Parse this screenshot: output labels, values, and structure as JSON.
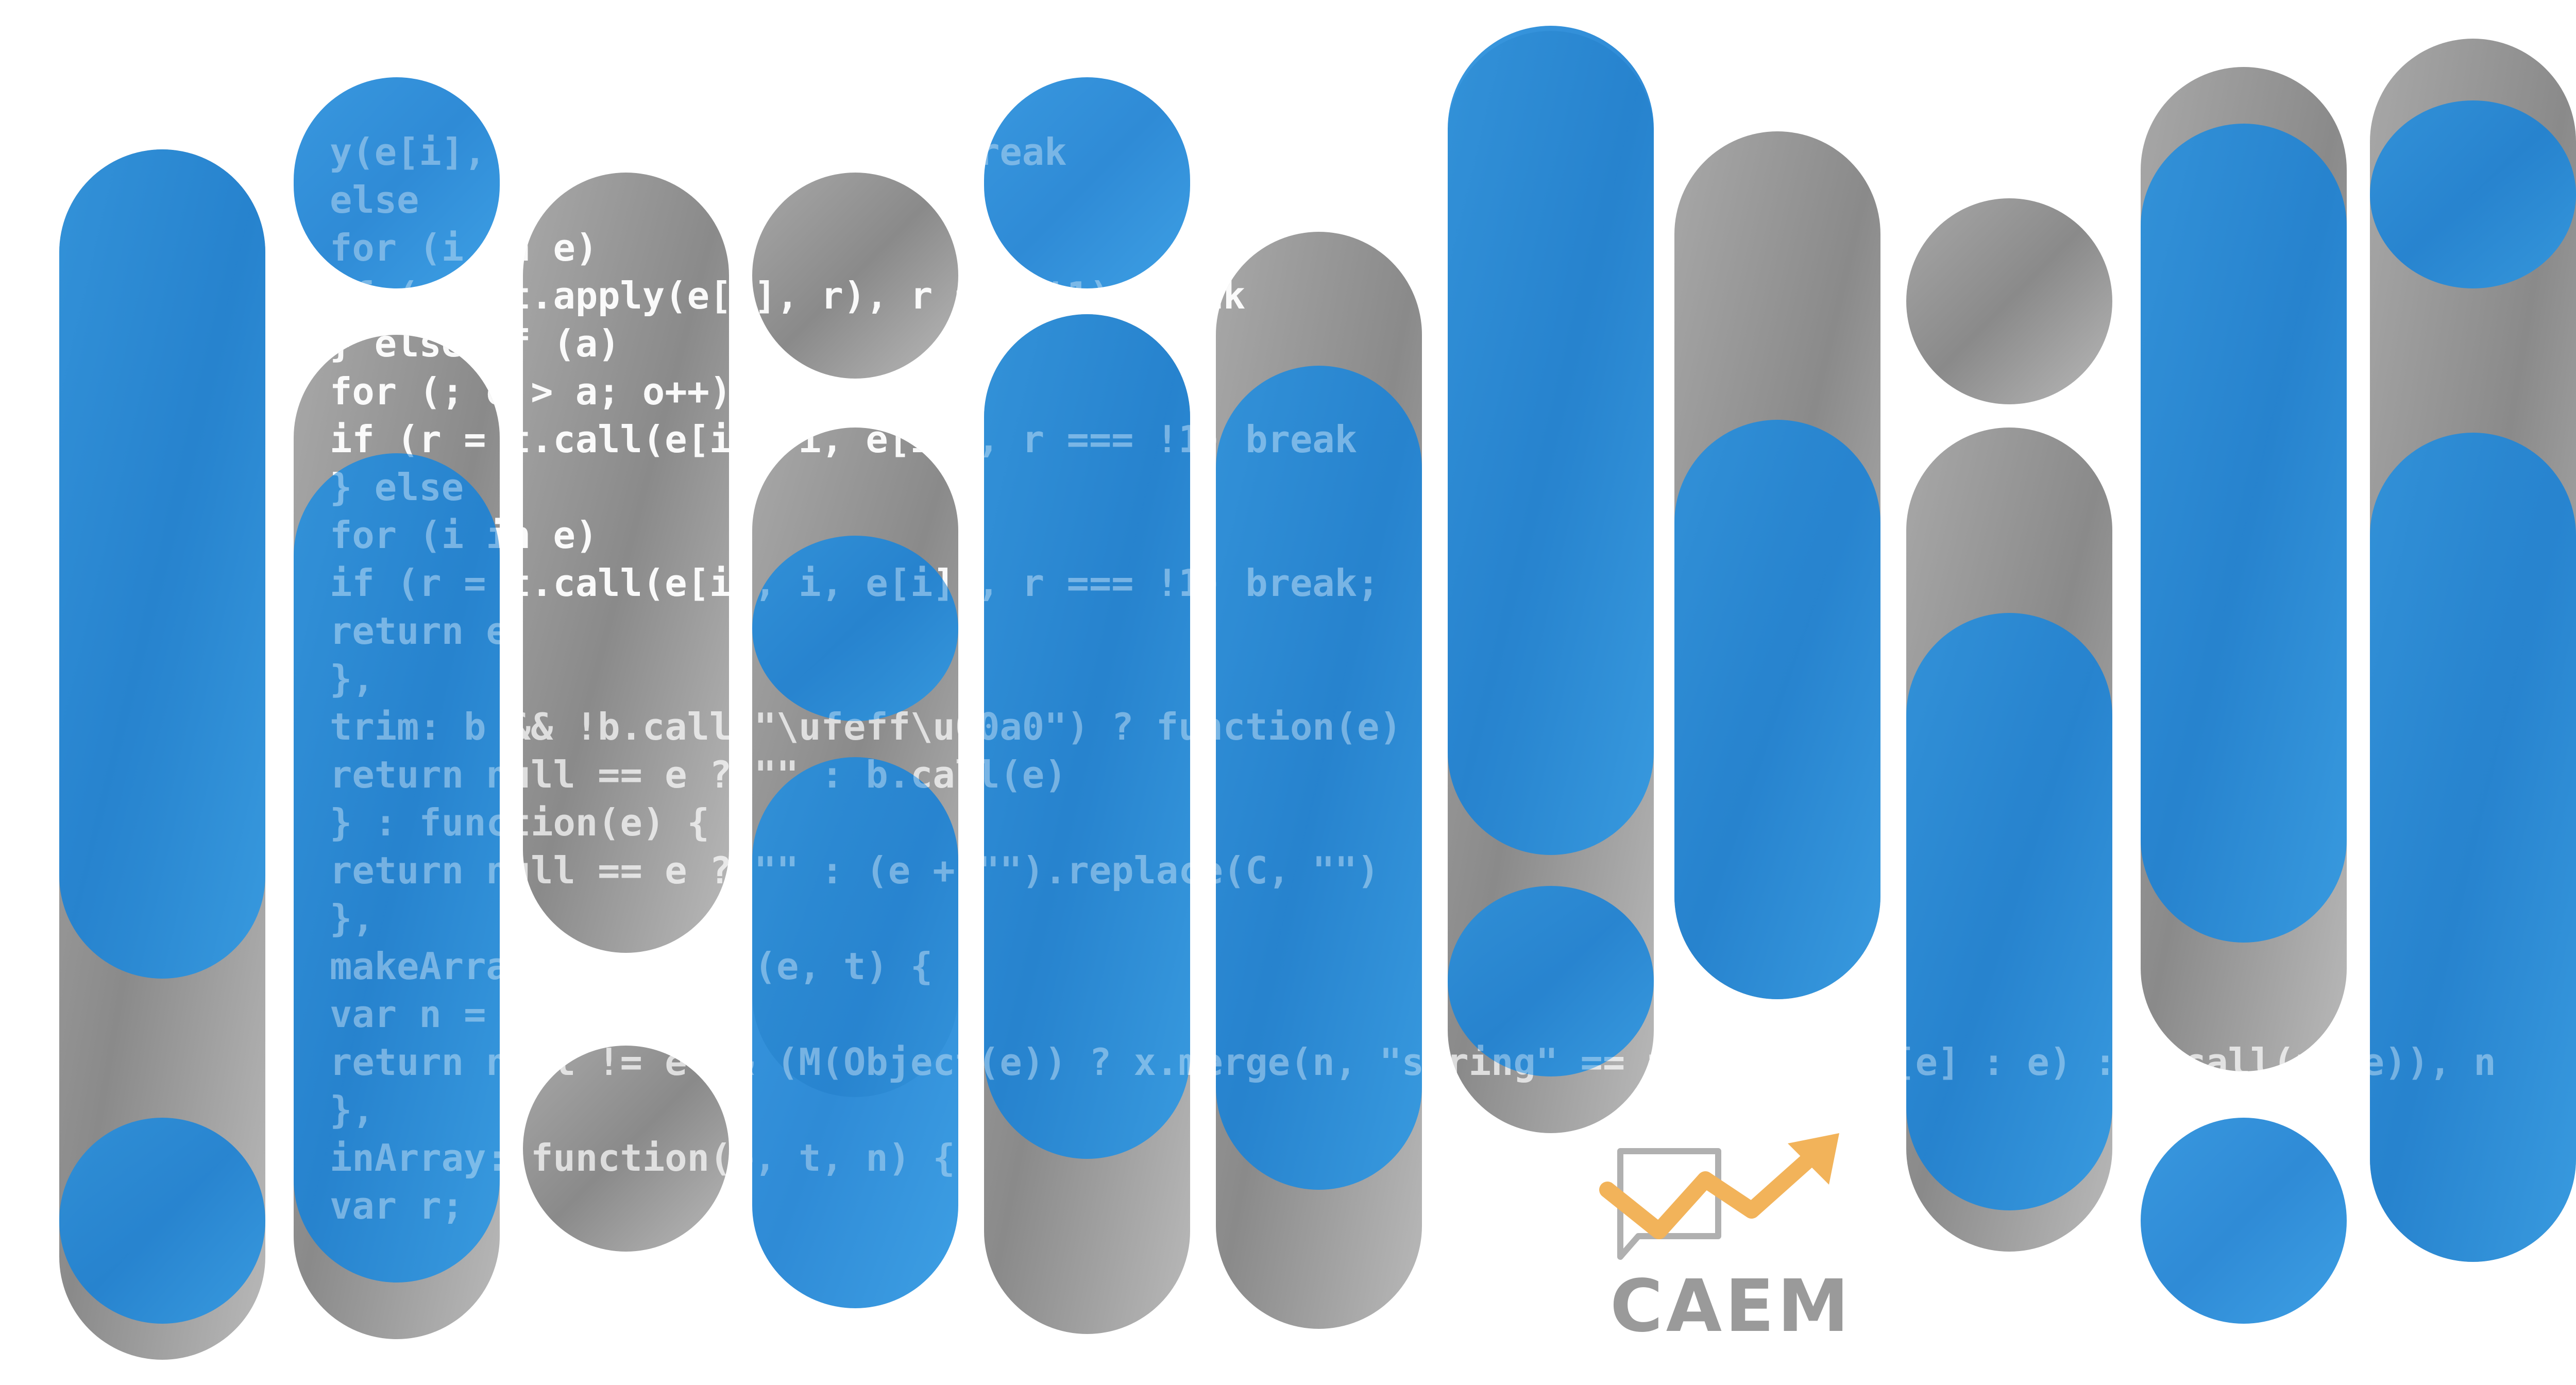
{
  "image": {
    "kind": "decorative-banner",
    "background": "#ffffff",
    "colors": {
      "blue": "#1f85d6",
      "blue_light": "#2f9ae6",
      "gray": "#8c8c8c",
      "gray_light": "#b4b4b4",
      "code_text": "#ffffff",
      "logo_gray": "#9a9a9a",
      "logo_orange": "#f2b35a"
    }
  },
  "code_lines": [
    "y(e[i], i, e[i]), r === !1) break",
    "    else",
    "        for (i in e)",
    "            if (r = t.apply(e[i], r), r === !1) break",
    "    } else if (a)",
    "        for (; o > a; o++)",
    "            if (r = t.call(e[i], i, e[i]), r === !1) break",
    "    } else",
    "        for (i in e)",
    "            if (r = t.call(e[i], i, e[i]), r === !1) break;",
    "    return e",
    "},",
    "trim: b && !b.call(\"\\ufeff\\u00a0\") ? function(e)",
    "    return null == e ? \"\" : b.call(e)",
    "} : function(e) {",
    "    return null == e ? \"\" : (e + \"\").replace(C, \"\")",
    "},",
    "makeArray: function(e, t) {",
    "    var n = t || [];",
    "    return null != e && (M(Object(e)) ? x.merge(n, \"string\" == typeof e ? [e] : e) : h.call(n, e)), n",
    "},",
    "inArray: function(e, t, n) {",
    "    var r;"
  ],
  "logo": {
    "text": "CAEM",
    "icon": "chat-bubble-rising-arrow-icon"
  }
}
